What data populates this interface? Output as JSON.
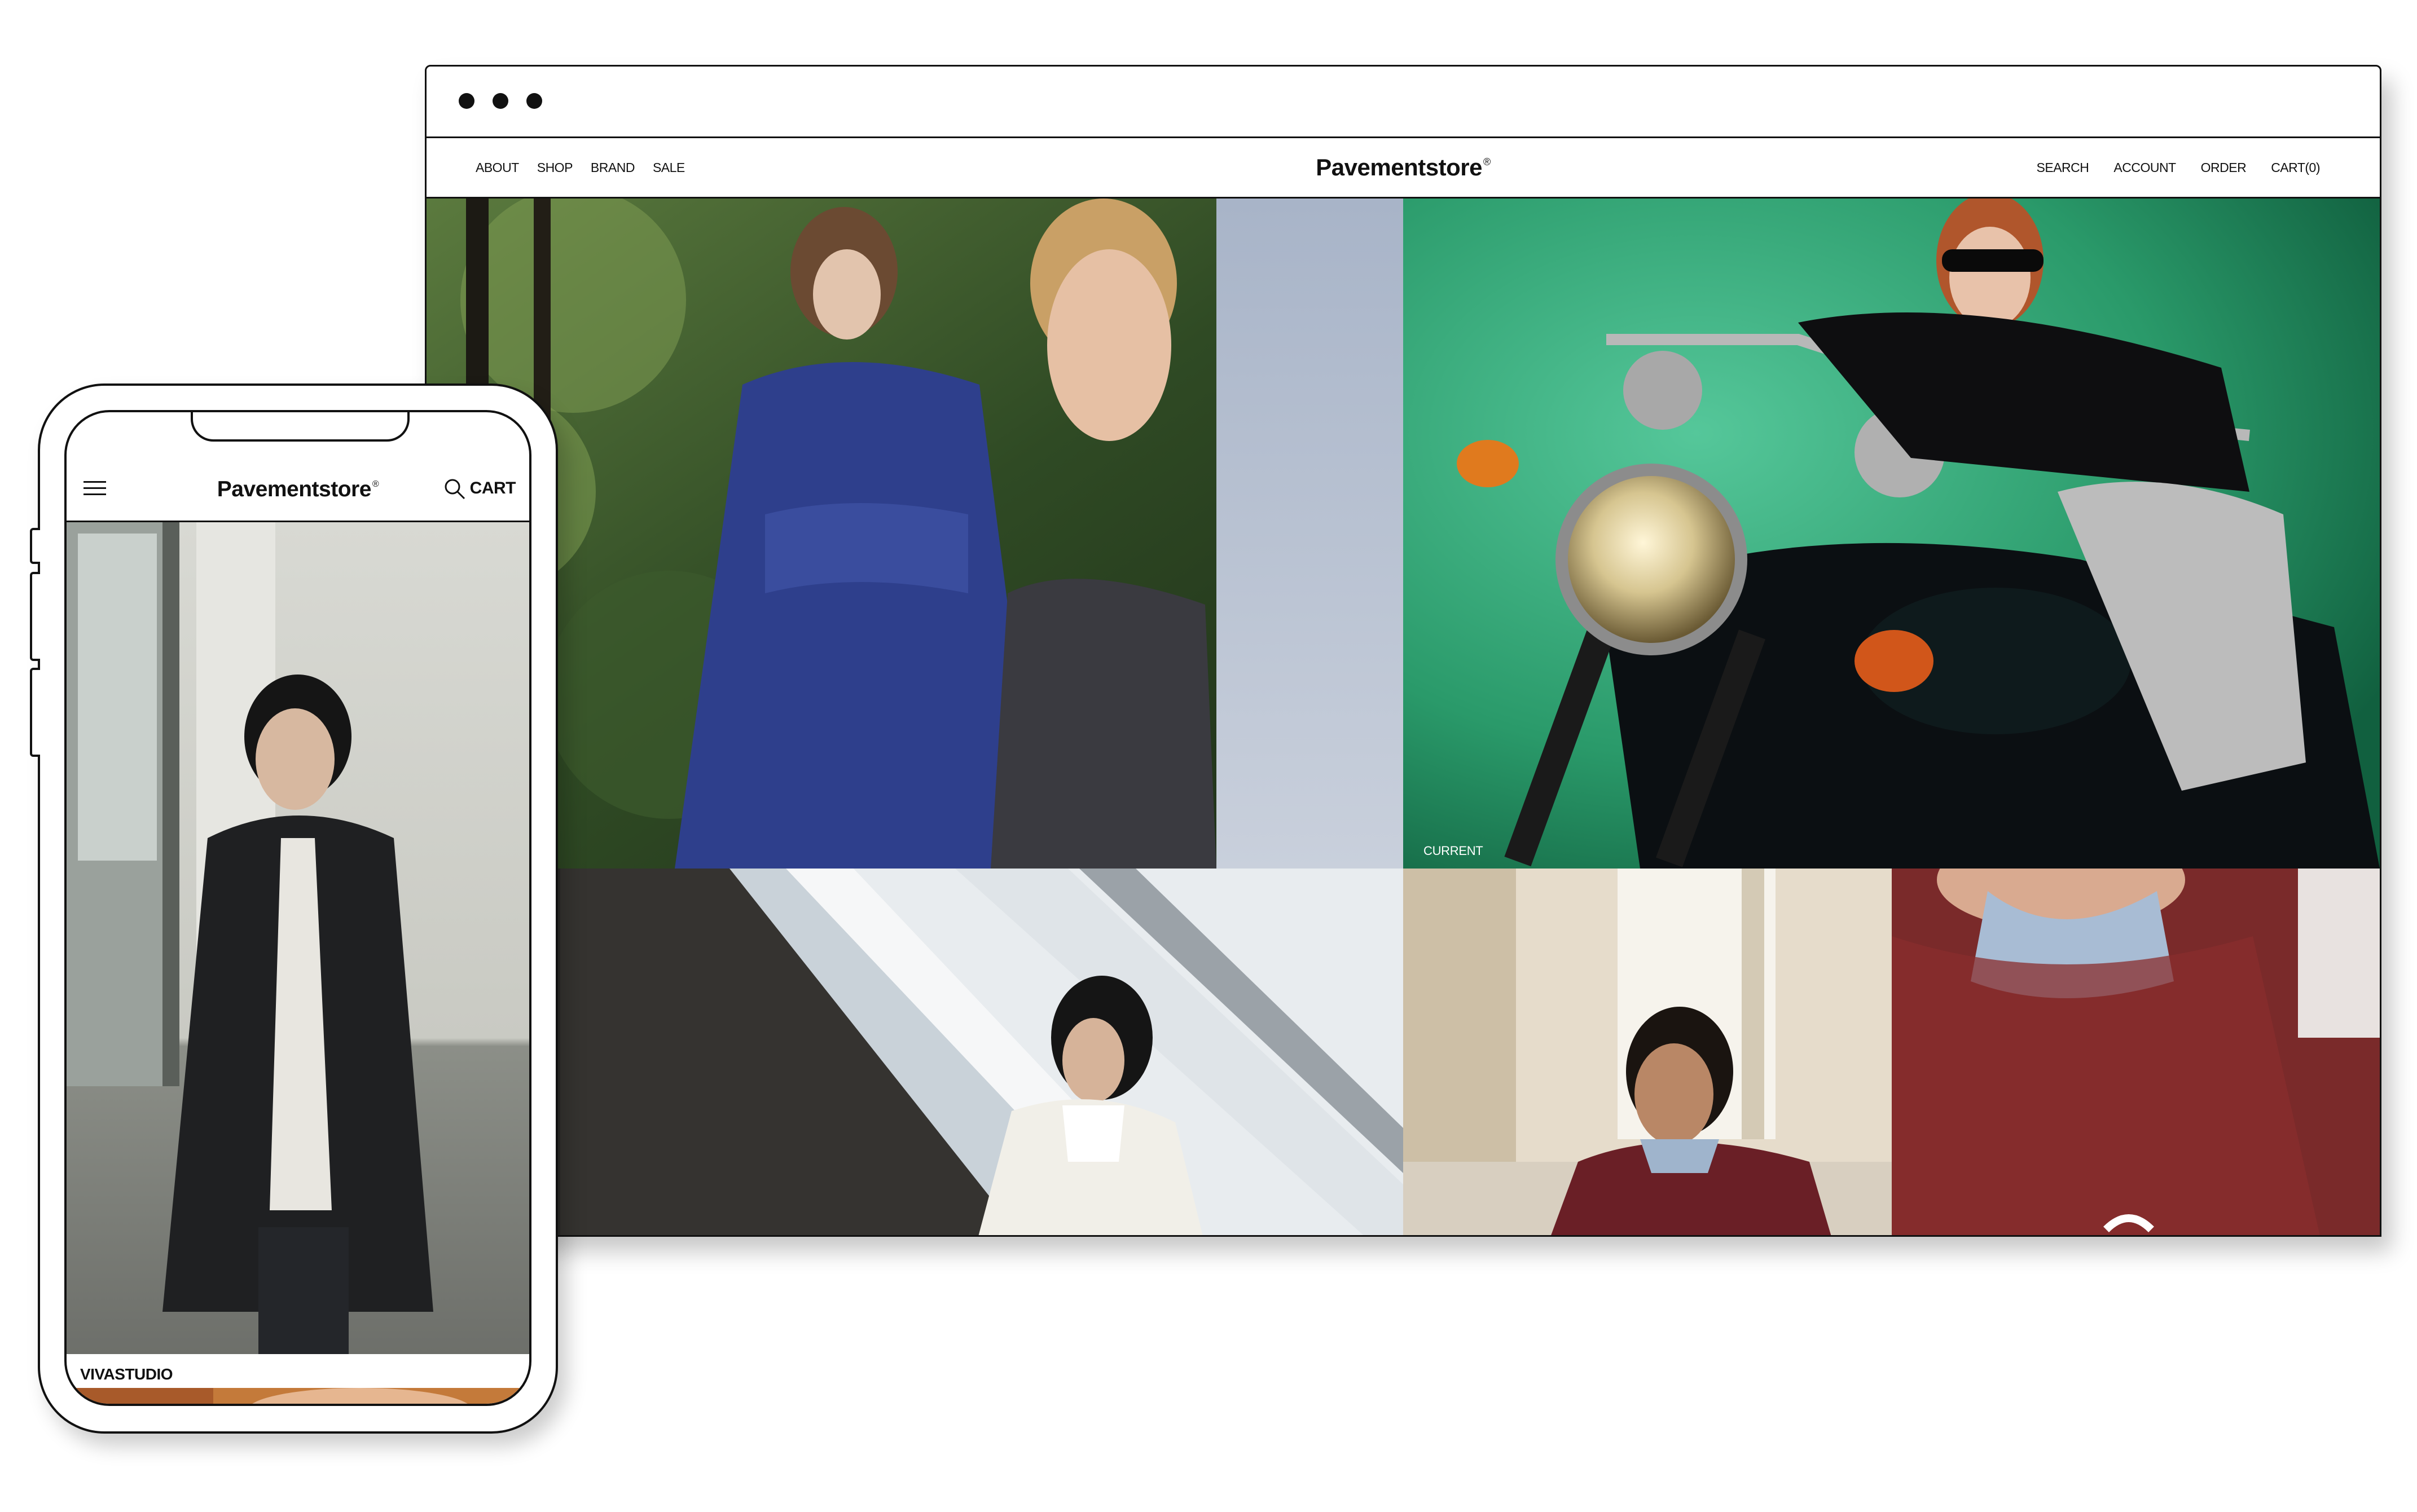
{
  "browser": {
    "nav_left": [
      "ABOUT",
      "SHOP",
      "BRAND",
      "SALE"
    ],
    "brand": "Pavementstore",
    "brand_mark": "®",
    "nav_right": [
      "SEARCH",
      "ACCOUNT",
      "ORDER",
      "CART(0)"
    ],
    "tiles": [
      {
        "caption": ""
      },
      {
        "caption": "CURRENT"
      },
      {
        "caption": ""
      },
      {
        "caption": ""
      },
      {
        "caption": ""
      }
    ]
  },
  "phone": {
    "brand": "Pavementstore",
    "brand_mark": "®",
    "cart_label": "CART",
    "feature_caption": "VIVASTUDIO"
  },
  "colors": {
    "background": "#ffffff",
    "ink": "#111111",
    "green_backdrop": "#2a9a6a",
    "burgundy": "#7a2a2a",
    "forest": "#2e4a2a"
  }
}
